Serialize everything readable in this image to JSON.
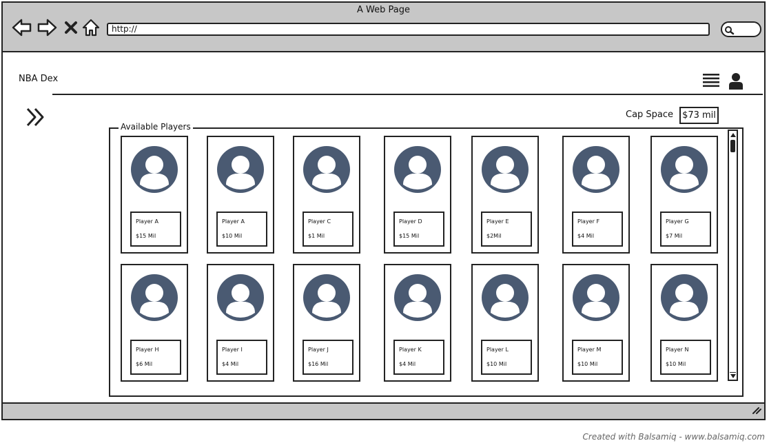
{
  "window": {
    "title": "A Web Page"
  },
  "browser": {
    "url": "http://",
    "icons": [
      "back-arrow-icon",
      "forward-arrow-icon",
      "close-x-icon",
      "home-icon",
      "search-icon"
    ]
  },
  "header": {
    "brand": "NBA Dex",
    "icons": [
      "menu-list-icon",
      "user-icon"
    ]
  },
  "sidebar_toggle_icon": "double-chevron-right-icon",
  "cap_space": {
    "label": "Cap Space",
    "value": "$73 mil"
  },
  "players_panel": {
    "title": "Available Players",
    "players": [
      {
        "name": "Player A",
        "salary": "$15 Mil"
      },
      {
        "name": "Player A",
        "salary": "$10 Mil"
      },
      {
        "name": "Player C",
        "salary": "$1 Mil"
      },
      {
        "name": "Player D",
        "salary": "$15 Mil"
      },
      {
        "name": "Player E",
        "salary": "$2Mil"
      },
      {
        "name": "Player F",
        "salary": "$4 Mil"
      },
      {
        "name": "Player G",
        "salary": "$7 Mil"
      },
      {
        "name": "Player H",
        "salary": "$6 Mil"
      },
      {
        "name": "Player I",
        "salary": "$4 Mil"
      },
      {
        "name": "Player J",
        "salary": "$16 Mil"
      },
      {
        "name": "Player K",
        "salary": "$4 Mil"
      },
      {
        "name": "Player L",
        "salary": "$10 Mil"
      },
      {
        "name": "Player M",
        "salary": "$10 Mil"
      },
      {
        "name": "Player N",
        "salary": "$10 Mil"
      }
    ]
  },
  "footer": {
    "credit": "Created with Balsamiq - www.balsamiq.com"
  },
  "colors": {
    "chrome": "#c7c7c7",
    "avatar": "#4a5a72",
    "stroke": "#222222"
  }
}
